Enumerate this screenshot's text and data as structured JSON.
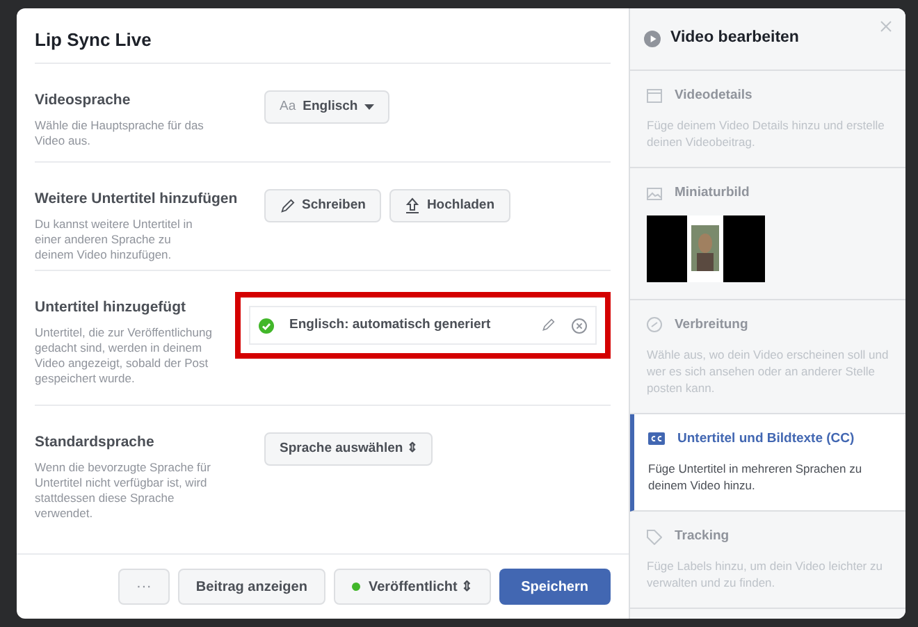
{
  "dialog": {
    "title": "Lip Sync Live",
    "rows": [
      {
        "kind": "select",
        "label": "Videosprache",
        "description": "Wähle die Hauptsprache für das Video aus.",
        "controls": [
          {
            "prefix": "Aa",
            "label": "Englisch",
            "kind": "caret"
          }
        ]
      },
      {
        "kind": "buttons",
        "label": "Weitere Untertitel hinzufügen",
        "description": "Du kannst weitere Untertitel in einer anderen Sprache zu deinem Video hinzufügen.",
        "controls": [
          {
            "label": "Schreiben",
            "kind": "pencil"
          },
          {
            "label": "Hochladen",
            "kind": "upload"
          }
        ]
      },
      {
        "kind": "subtitle",
        "label": "Untertitel hinzugefügt",
        "description": "Untertitel, die zur Veröffentlichung gedacht sind, werden in deinem Video angezeigt, sobald der Post gespeichert wurde.",
        "item": {
          "label": "Englisch: automatisch generiert",
          "highlighted": true
        }
      },
      {
        "kind": "select",
        "label": "Standardsprache",
        "description": "Wenn die bevorzugte Sprache für Untertitel nicht verfügbar ist, wird stattdessen diese Sprache verwendet.",
        "controls": [
          {
            "label": "Sprache auswählen ⇕",
            "kind": "plain"
          }
        ]
      }
    ],
    "footer": [
      {
        "kind": "more",
        "label": "···"
      },
      {
        "kind": "secondary",
        "label": "Beitrag anzeigen"
      },
      {
        "kind": "status",
        "label": "Veröffentlicht ⇕",
        "color": "#42b72a"
      },
      {
        "kind": "primary",
        "label": "Speichern"
      }
    ]
  },
  "sidebar": {
    "title": "Video bearbeiten",
    "sections": [
      {
        "kind": "details",
        "title": "Videodetails",
        "description": "Füge deinem Video Details hinzu und erstelle deinen Videobeitrag.",
        "selected": false
      },
      {
        "kind": "thumbnail",
        "title": "Miniaturbild",
        "selected": false
      },
      {
        "kind": "distribution",
        "title": "Verbreitung",
        "description": "Wähle aus, wo dein Video erscheinen soll und wer es sich ansehen oder an anderer Stelle posten kann.",
        "selected": false
      },
      {
        "kind": "captions",
        "title": "Untertitel und Bildtexte (CC)",
        "description": "Füge Untertitel in mehreren Sprachen zu deinem Video hinzu.",
        "selected": true
      },
      {
        "kind": "tracking",
        "title": "Tracking",
        "description": "Füge Labels hinzu, um dein Video leichter zu verwalten und zu finden.",
        "selected": false
      }
    ]
  }
}
